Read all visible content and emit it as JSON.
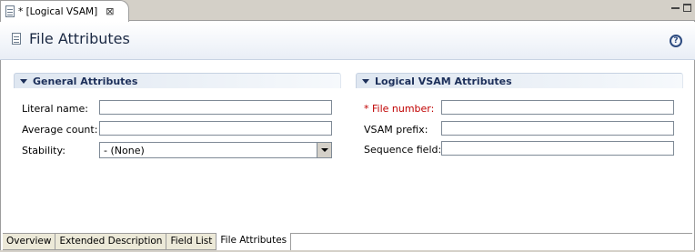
{
  "editor_tab": {
    "title": "* [Logical VSAM]",
    "close_glyph": "⊠"
  },
  "header": {
    "title": "File Attributes",
    "help_glyph": "?"
  },
  "general_section": {
    "title": "General Attributes",
    "literal_name_label": "Literal name:",
    "literal_name_value": "",
    "average_count_label": "Average count:",
    "average_count_value": "",
    "stability_label": "Stability:",
    "stability_value": "- (None)"
  },
  "vsam_section": {
    "title": "Logical VSAM Attributes",
    "file_number_label": "* File number:",
    "file_number_value": "",
    "vsam_prefix_label": "VSAM prefix:",
    "vsam_prefix_value": "",
    "sequence_field_label": "Sequence field:",
    "sequence_field_value": ""
  },
  "bottom_tabs": [
    {
      "label": "Overview",
      "active": false
    },
    {
      "label": "Extended Description",
      "active": false
    },
    {
      "label": "Field List",
      "active": false
    },
    {
      "label": "File Attributes",
      "active": true
    }
  ],
  "colors": {
    "required": "#c00000",
    "section_title": "#1c2f5a",
    "header_title": "#1c2a44"
  }
}
